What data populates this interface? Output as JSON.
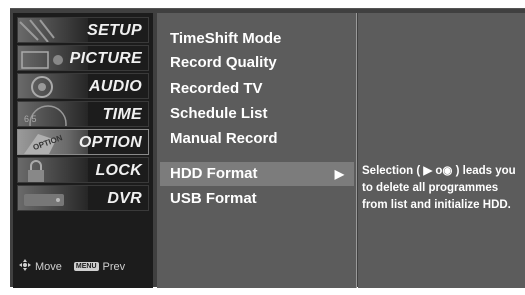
{
  "categories": [
    {
      "label": "SETUP",
      "icon": "setup-icon"
    },
    {
      "label": "PICTURE",
      "icon": "picture-icon"
    },
    {
      "label": "AUDIO",
      "icon": "audio-icon"
    },
    {
      "label": "TIME",
      "icon": "time-icon"
    },
    {
      "label": "OPTION",
      "icon": "option-icon",
      "active": true
    },
    {
      "label": "LOCK",
      "icon": "lock-icon"
    },
    {
      "label": "DVR",
      "icon": "dvr-icon"
    }
  ],
  "hints": {
    "move_label": "Move",
    "menu_key": "MENU",
    "prev_label": "Prev"
  },
  "menu": {
    "items": [
      {
        "label": "TimeShift Mode"
      },
      {
        "label": "Record Quality"
      },
      {
        "label": "Recorded TV"
      },
      {
        "label": "Schedule List"
      },
      {
        "label": "Manual Record"
      },
      {
        "label": "HDD Format",
        "selected": true,
        "arrow": "▶"
      },
      {
        "label": "USB Format"
      }
    ]
  },
  "description": "Selection ( ▶ o◉ ) leads you to delete all programmes from list and initialize HDD.",
  "colors": {
    "background": "#404040",
    "menu_panel": "#5c5c5c",
    "selected_item": "#7c7c7c",
    "text": "#ffffff"
  }
}
